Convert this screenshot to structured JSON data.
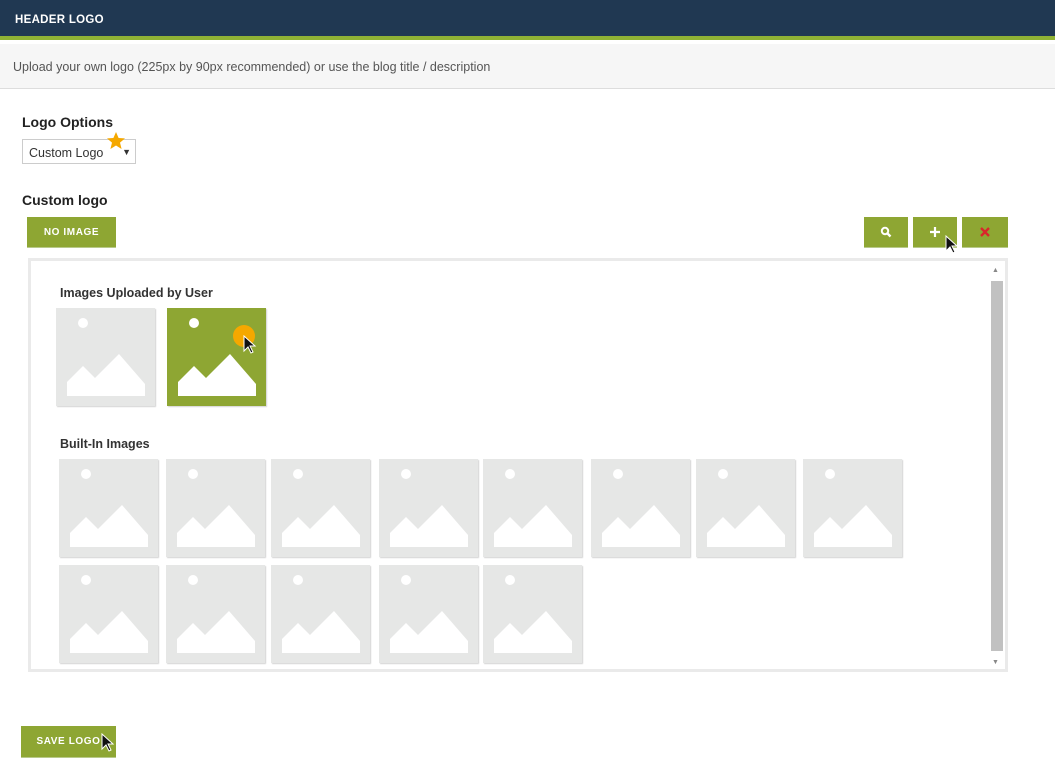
{
  "header": {
    "title": "HEADER LOGO"
  },
  "description": "Upload your own logo (225px by 90px recommended) or use the blog title / description",
  "logo_options": {
    "label": "Logo Options",
    "selected": "Custom Logo"
  },
  "custom_logo": {
    "label": "Custom logo",
    "no_image_label": "NO IMAGE",
    "search_icon": "search-icon",
    "add_icon": "plus-icon",
    "remove_icon": "close-icon"
  },
  "gallery": {
    "uploaded_label": "Images Uploaded by User",
    "uploaded_count": 2,
    "selected_index": 1,
    "builtin_label": "Built-In Images",
    "builtin_count": 13
  },
  "save_label": "SAVE LOGO",
  "colors": {
    "header": "#203852",
    "accent": "#8fb235",
    "button": "#8ea633",
    "remove": "#d9262b"
  }
}
